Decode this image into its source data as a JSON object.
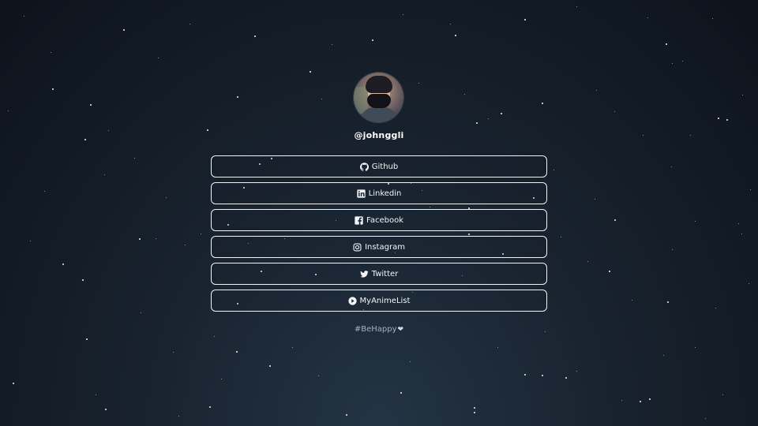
{
  "profile": {
    "handle": "@johnggli"
  },
  "links": [
    {
      "label": "Github",
      "icon": "github-icon"
    },
    {
      "label": "Linkedin",
      "icon": "linkedin-icon"
    },
    {
      "label": "Facebook",
      "icon": "facebook-icon"
    },
    {
      "label": "Instagram",
      "icon": "instagram-icon"
    },
    {
      "label": "Twitter",
      "icon": "twitter-icon"
    },
    {
      "label": "MyAnimeList",
      "icon": "play-circle-icon"
    }
  ],
  "footer": {
    "text": "#BeHappy",
    "heart": "❤"
  },
  "colors": {
    "background": "#18222e",
    "button_border": "#f1f3f7",
    "footer_text": "#a9b0b7"
  }
}
